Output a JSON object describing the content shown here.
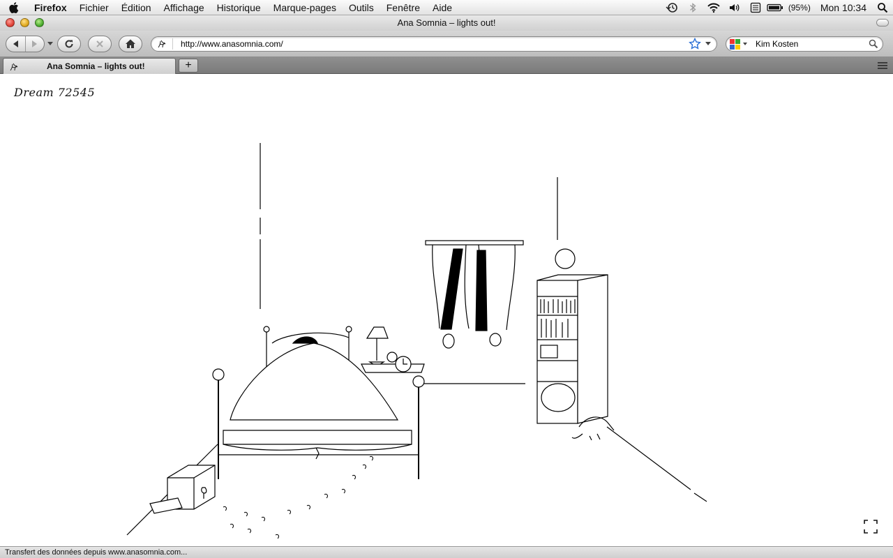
{
  "menubar": {
    "app_name": "Firefox",
    "items": [
      "Fichier",
      "Édition",
      "Affichage",
      "Historique",
      "Marque-pages",
      "Outils",
      "Fenêtre",
      "Aide"
    ],
    "battery": "(95%)",
    "clock": "Mon 10:34"
  },
  "window": {
    "title": "Ana Somnia – lights out!"
  },
  "toolbar": {
    "url": "http://www.anasomnia.com/",
    "search_value": "Kim Kosten"
  },
  "tabs": [
    {
      "label": "Ana Somnia – lights out!"
    }
  ],
  "content": {
    "dream_label": "Dream 72545"
  },
  "statusbar": {
    "text": "Transfert des données depuis www.anasomnia.com..."
  }
}
